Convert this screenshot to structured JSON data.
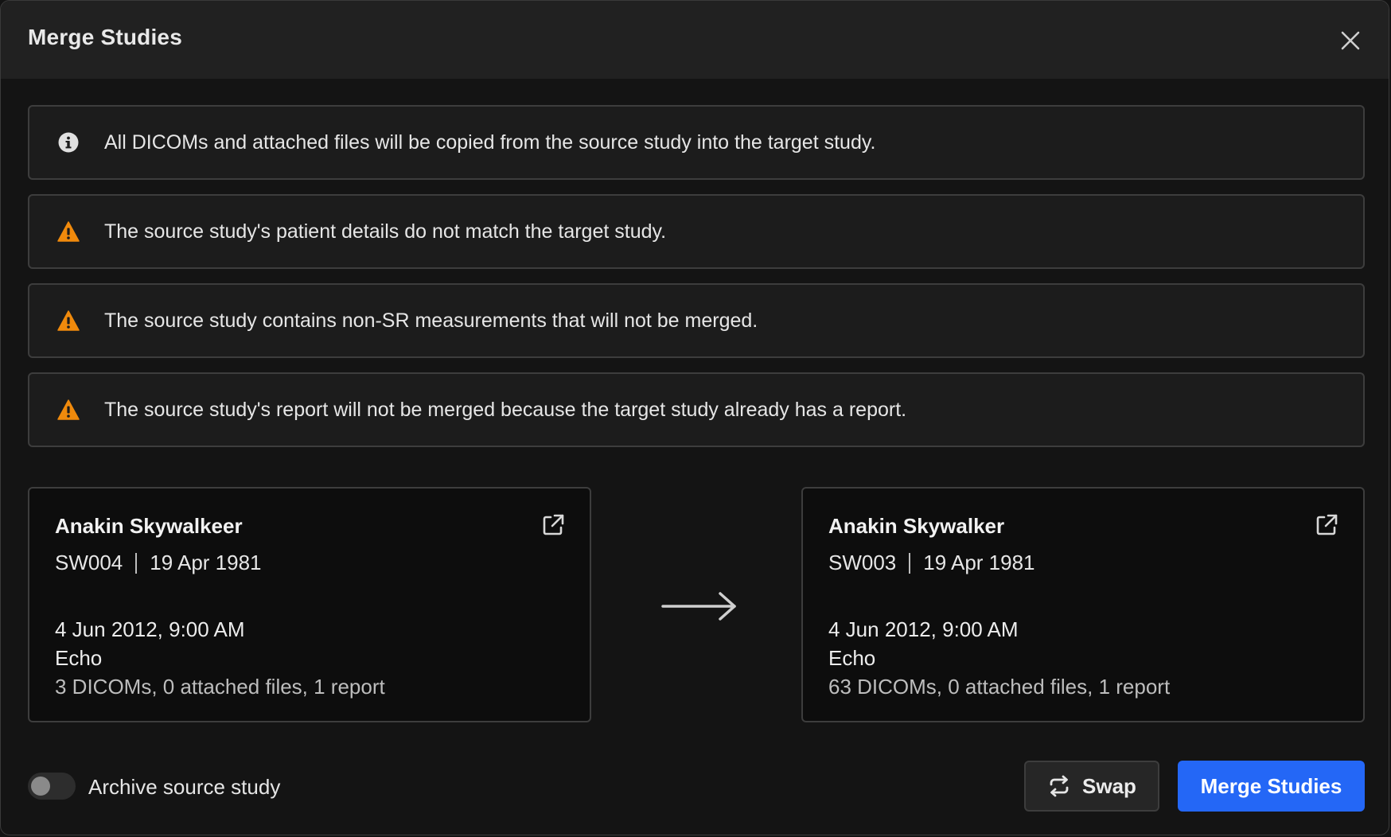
{
  "dialog": {
    "title": "Merge Studies"
  },
  "alerts": [
    {
      "type": "info",
      "icon": "info-icon",
      "text": "All DICOMs and attached files will be copied from the source study into the target study."
    },
    {
      "type": "warning",
      "icon": "warning-icon",
      "text": "The source study's patient details do not match the target study."
    },
    {
      "type": "warning",
      "icon": "warning-icon",
      "text": "The source study contains non-SR measurements that will not be merged."
    },
    {
      "type": "warning",
      "icon": "warning-icon",
      "text": "The source study's report will not be merged because the target study already has a report."
    }
  ],
  "source": {
    "name": "Anakin Skywalkeer",
    "id": "SW004",
    "dob": "19 Apr 1981",
    "study_date": "4 Jun 2012, 9:00 AM",
    "modality": "Echo",
    "counts": "3 DICOMs, 0 attached files, 1 report"
  },
  "target": {
    "name": "Anakin Skywalker",
    "id": "SW003",
    "dob": "19 Apr 1981",
    "study_date": "4 Jun 2012, 9:00 AM",
    "modality": "Echo",
    "counts": "63 DICOMs, 0 attached files, 1 report"
  },
  "footer": {
    "archive_label": "Archive source study",
    "archive_enabled": false,
    "swap_label": "Swap",
    "merge_label": "Merge Studies"
  },
  "colors": {
    "warning": "#f08a0c",
    "primary": "#2467f6",
    "info": "#e0e0e0"
  }
}
